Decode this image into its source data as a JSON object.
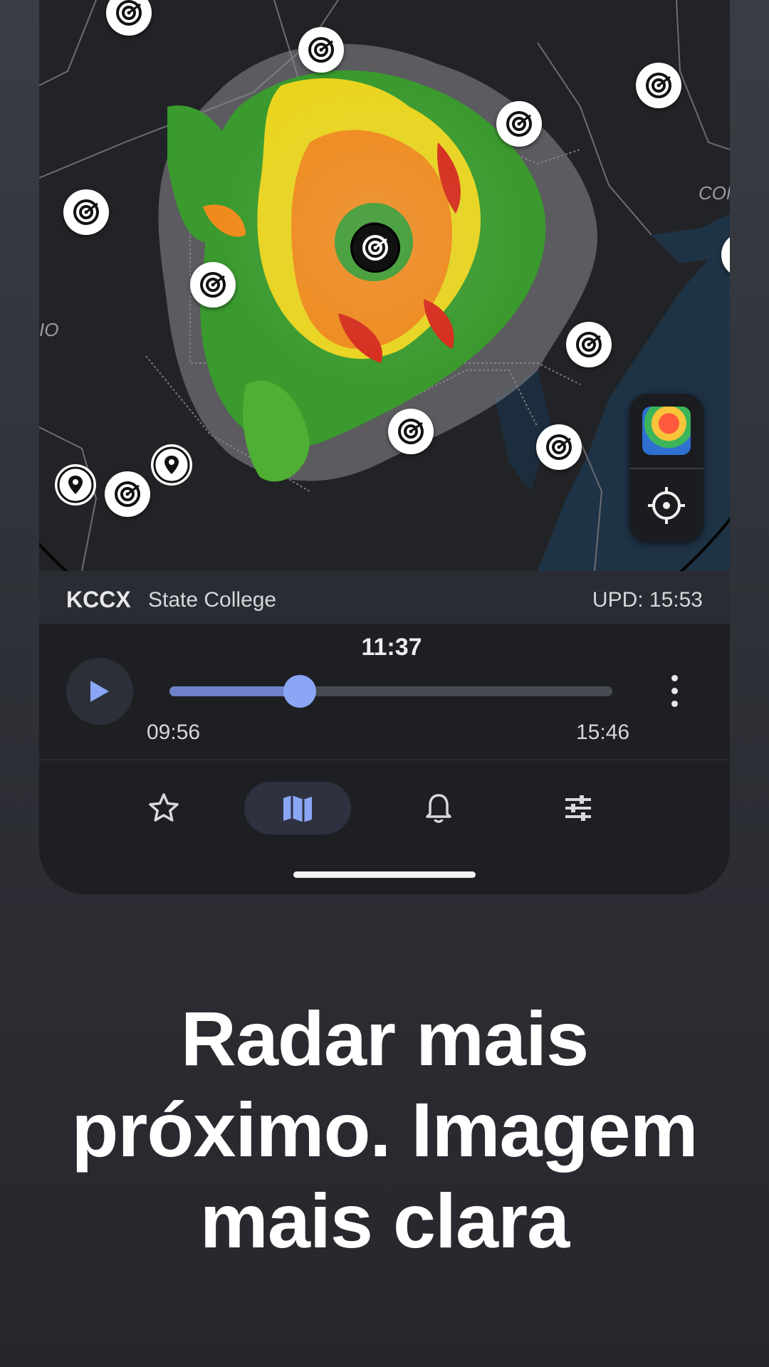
{
  "map": {
    "labels": [
      "CON",
      "IO"
    ],
    "radar_sites": [
      {
        "name": "radar-site"
      },
      {
        "name": "radar-site"
      }
    ]
  },
  "station": {
    "code": "KCCX",
    "name": "State College",
    "updated": "UPD: 15:53"
  },
  "player": {
    "current_time": "11:37",
    "start_time": "09:56",
    "end_time": "15:46",
    "progress": 0.295
  },
  "nav": {
    "items": [
      {
        "icon": "star-icon",
        "active": false
      },
      {
        "icon": "map-icon",
        "active": true
      },
      {
        "icon": "bell-icon",
        "active": false
      },
      {
        "icon": "sliders-icon",
        "active": false
      }
    ]
  },
  "headline": {
    "lines": [
      "Radar mais",
      "próximo. Imagem",
      "mais clara"
    ]
  },
  "colors": {
    "accent": "#8aa6f5",
    "background": "#2f3138",
    "panel": "#1e1f23"
  }
}
